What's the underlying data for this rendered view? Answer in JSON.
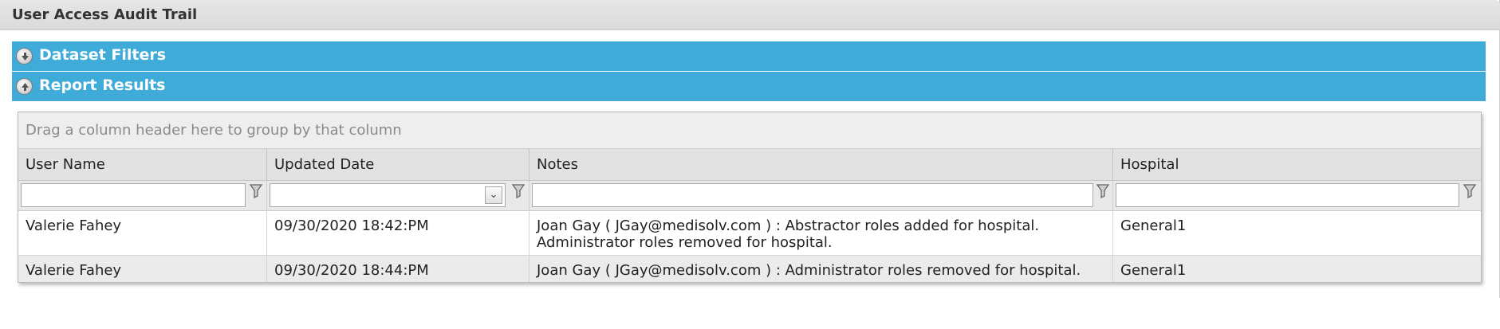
{
  "page": {
    "title": "User Access Audit Trail"
  },
  "sections": {
    "filters_label": "Dataset Filters",
    "results_label": "Report Results"
  },
  "grid": {
    "group_hint": "Drag a column header here to group by that column",
    "columns": [
      "User Name",
      "Updated Date",
      "Notes",
      "Hospital"
    ],
    "filters": {
      "user_name": "",
      "updated_date": "",
      "notes": "",
      "hospital": ""
    },
    "rows": [
      {
        "user_name": "Valerie Fahey",
        "updated_date": "09/30/2020 18:42:PM",
        "notes_line1": "Joan Gay ( JGay@medisolv.com ) : Abstractor roles added for hospital.",
        "notes_line2": "Administrator roles removed for hospital.",
        "hospital": "General1"
      },
      {
        "user_name": "Valerie Fahey",
        "updated_date": "09/30/2020 18:44:PM",
        "notes_line1": "Joan Gay ( JGay@medisolv.com ) : Administrator roles removed for hospital.",
        "hospital": "General1"
      }
    ]
  },
  "icons": {
    "filters_toggle": "expand-down-icon",
    "results_toggle": "collapse-up-icon",
    "filter": "funnel-filter-icon",
    "dropdown": "chevron-down-icon"
  },
  "colors": {
    "section_bar": "#3eabd9",
    "title_bar": "#dedede",
    "alt_row": "#ebebeb"
  }
}
